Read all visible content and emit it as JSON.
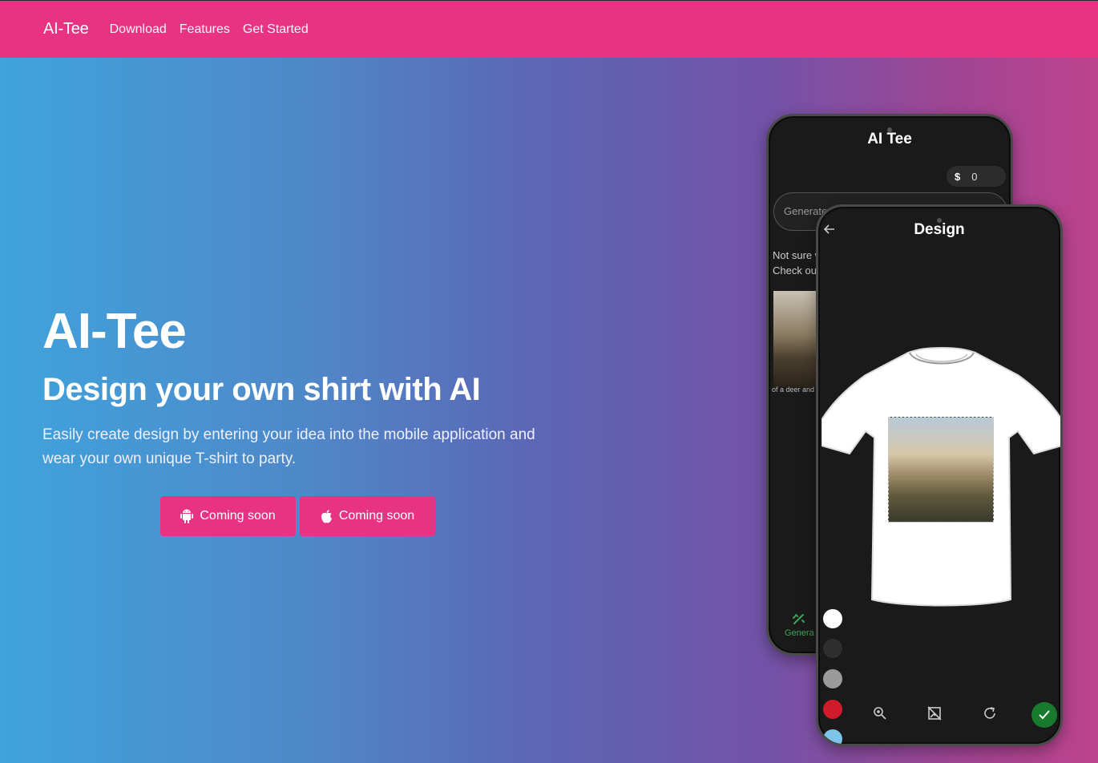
{
  "nav": {
    "brand": "AI-Tee",
    "links": [
      "Download",
      "Features",
      "Get Started"
    ]
  },
  "hero": {
    "title": "AI-Tee",
    "subtitle": "Design your own shirt with AI",
    "text": "Easily create design by entering your idea into the mobile application and wear your own unique T-shirt to party.",
    "buttons": [
      {
        "label": "Coming soon",
        "icon": "android-icon"
      },
      {
        "label": "Coming soon",
        "icon": "apple-icon"
      }
    ]
  },
  "app_back": {
    "title": "AI Tee",
    "balance_symbol": "$",
    "balance": "0",
    "input_placeholder": "Generate",
    "hint_line1": "Not sure w",
    "hint_line2": "Check out",
    "thumb_caption": "of a deer and",
    "tab_label": "Genera"
  },
  "app_front": {
    "title": "Design",
    "swatch_colors": [
      "#ffffff",
      "#2e2e2e",
      "#9b9b9b",
      "#d11a2a",
      "#7ec3e8",
      "#8bc34a"
    ]
  },
  "colors": {
    "brand": "#e83283",
    "confirm": "#177a2c"
  }
}
